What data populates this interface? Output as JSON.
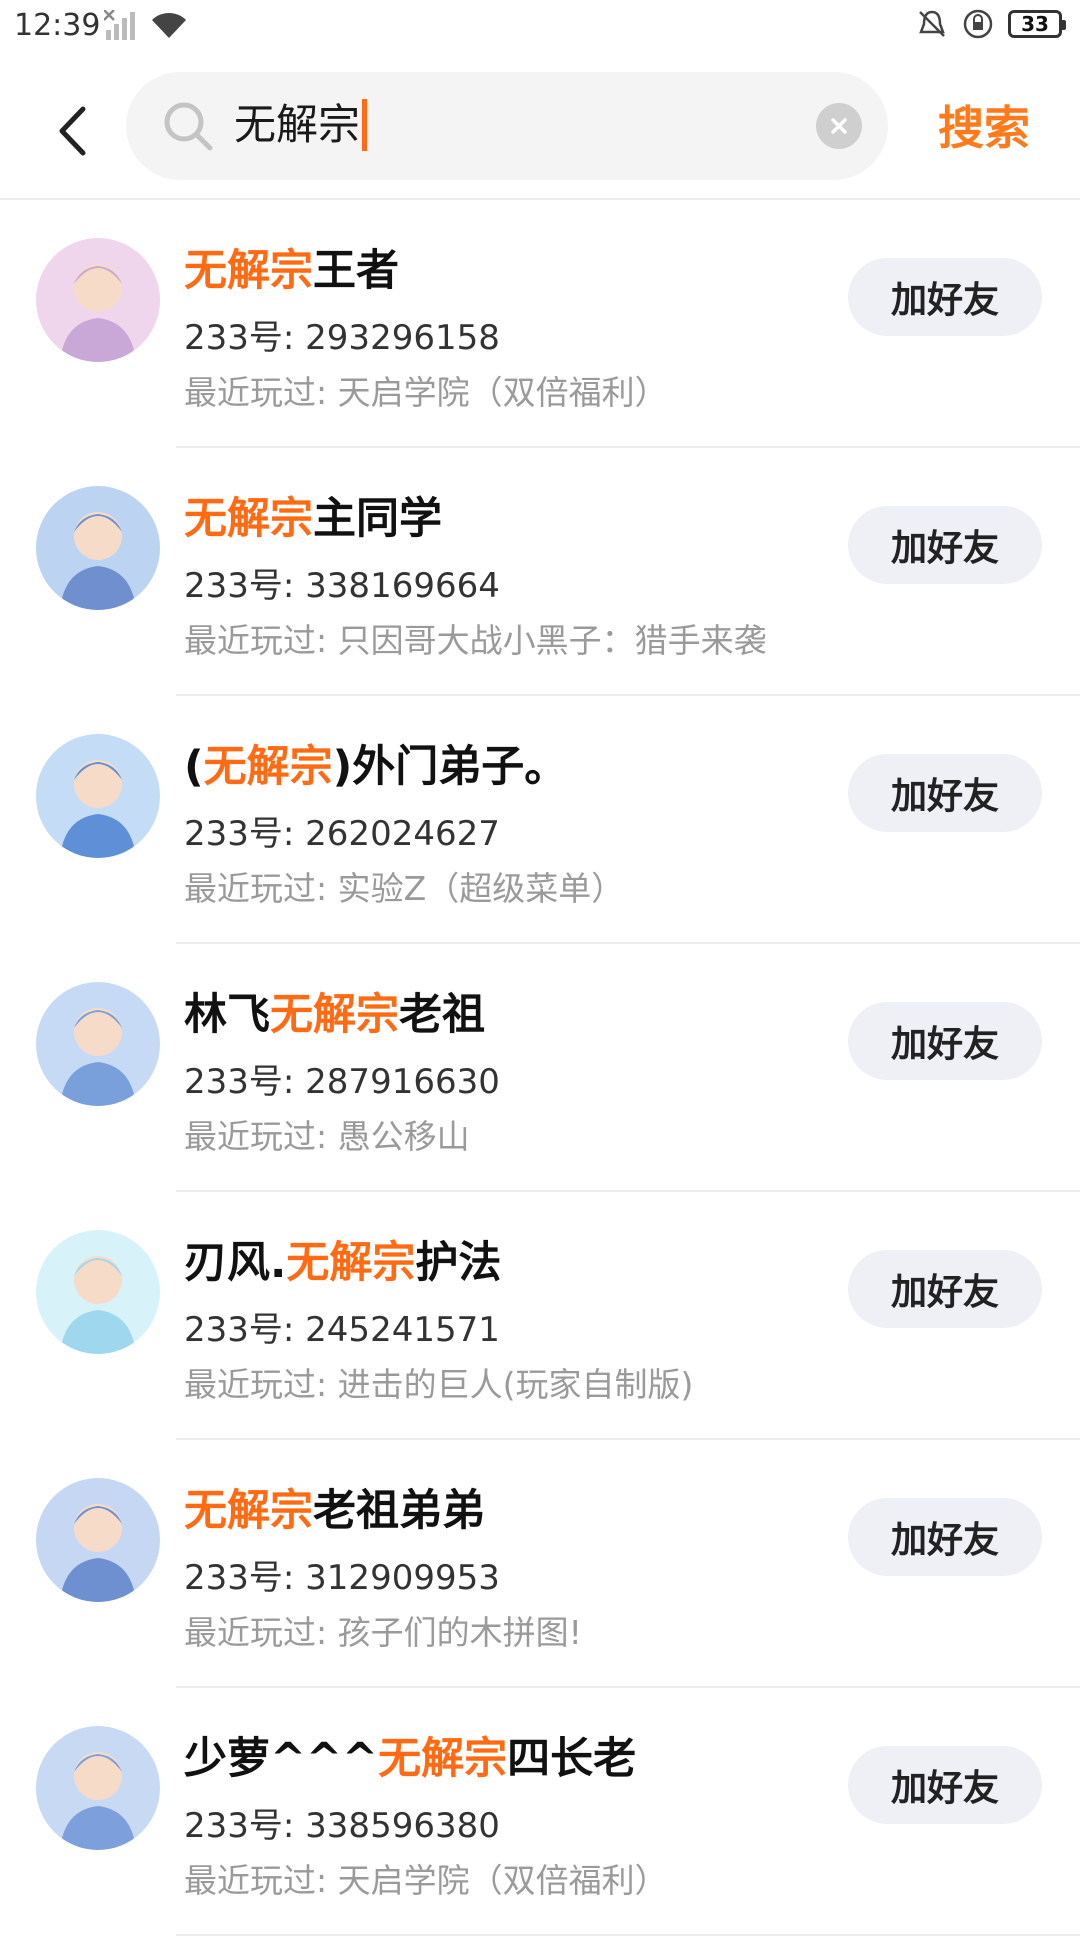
{
  "status_bar": {
    "time": "12:39",
    "battery": "33"
  },
  "search": {
    "query": "无解宗",
    "button_label": "搜索"
  },
  "results": [
    {
      "name_parts": [
        {
          "text": "无解宗",
          "hl": true
        },
        {
          "text": "王者",
          "hl": false
        }
      ],
      "uid_label": "233号: ",
      "uid": "293296158",
      "played_label": "最近玩过: ",
      "played": "天启学院（双倍福利）",
      "button": "加好友",
      "avatar_colors": [
        "#f0d6ec",
        "#c9a8d8"
      ]
    },
    {
      "name_parts": [
        {
          "text": "无解宗",
          "hl": true
        },
        {
          "text": "主同学",
          "hl": false
        }
      ],
      "uid_label": "233号: ",
      "uid": "338169664",
      "played_label": "最近玩过: ",
      "played": "只因哥大战小黑子：猎手来袭",
      "button": "加好友",
      "avatar_colors": [
        "#bcd3f2",
        "#6f8fcf"
      ]
    },
    {
      "name_parts": [
        {
          "text": "(",
          "hl": false
        },
        {
          "text": "无解宗",
          "hl": true
        },
        {
          "text": ")外门弟子。",
          "hl": false
        }
      ],
      "uid_label": "233号: ",
      "uid": "262024627",
      "played_label": "最近玩过: ",
      "played": "实验Z（超级菜单）",
      "button": "加好友",
      "avatar_colors": [
        "#c5dcf6",
        "#5f8fd6"
      ]
    },
    {
      "name_parts": [
        {
          "text": "林飞",
          "hl": false
        },
        {
          "text": "无解宗",
          "hl": true
        },
        {
          "text": "老祖",
          "hl": false
        }
      ],
      "uid_label": "233号: ",
      "uid": "287916630",
      "played_label": "最近玩过: ",
      "played": "愚公移山",
      "button": "加好友",
      "avatar_colors": [
        "#c7daf5",
        "#7aa0dc"
      ]
    },
    {
      "name_parts": [
        {
          "text": "刃风.",
          "hl": false
        },
        {
          "text": "无解宗",
          "hl": true
        },
        {
          "text": "护法",
          "hl": false
        }
      ],
      "uid_label": "233号: ",
      "uid": "245241571",
      "played_label": "最近玩过: ",
      "played": "进击的巨人(玩家自制版)",
      "button": "加好友",
      "avatar_colors": [
        "#d8f2fa",
        "#9fd8ee"
      ]
    },
    {
      "name_parts": [
        {
          "text": "无解宗",
          "hl": true
        },
        {
          "text": "老祖弟弟",
          "hl": false
        }
      ],
      "uid_label": "233号: ",
      "uid": "312909953",
      "played_label": "最近玩过: ",
      "played": "孩子们的木拼图!",
      "button": "加好友",
      "avatar_colors": [
        "#c6d7f4",
        "#6e8fd0"
      ]
    },
    {
      "name_parts": [
        {
          "text": "少萝^^^",
          "hl": false
        },
        {
          "text": "无解宗",
          "hl": true
        },
        {
          "text": "四长老",
          "hl": false
        }
      ],
      "uid_label": "233号: ",
      "uid": "338596380",
      "played_label": "最近玩过: ",
      "played": "天启学院（双倍福利）",
      "button": "加好友",
      "avatar_colors": [
        "#c8d9f4",
        "#7d9fdc"
      ]
    }
  ]
}
